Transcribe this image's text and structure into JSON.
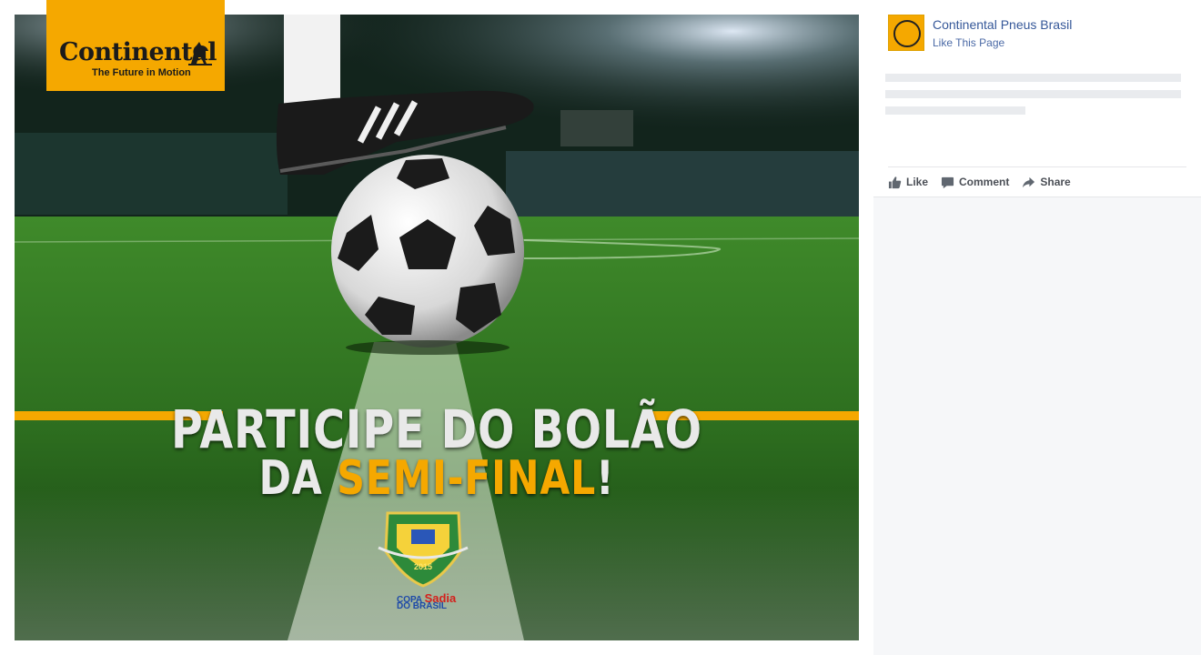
{
  "post": {
    "brand": {
      "name": "Continental",
      "tagline": "The Future in Motion"
    },
    "headline": {
      "line1": "PARTICIPE DO BOLÃO",
      "line2_prefix": "DA ",
      "line2_accent": "SEMI-FINAL",
      "line2_suffix": "!"
    },
    "cup": {
      "year": "2015",
      "line1_a": "COPA ",
      "line1_b": "Sadia",
      "line2": "DO BRASIL"
    },
    "colors": {
      "brand_yellow": "#f5a800",
      "link_blue": "#365899",
      "action_gray": "#4b4f56"
    }
  },
  "sidebar": {
    "page_name": "Continental Pneus Brasil",
    "like_page": "Like This Page",
    "actions": [
      {
        "label": "Like",
        "icon": "thumbs-up-icon"
      },
      {
        "label": "Comment",
        "icon": "comment-icon"
      },
      {
        "label": "Share",
        "icon": "share-icon"
      }
    ]
  }
}
